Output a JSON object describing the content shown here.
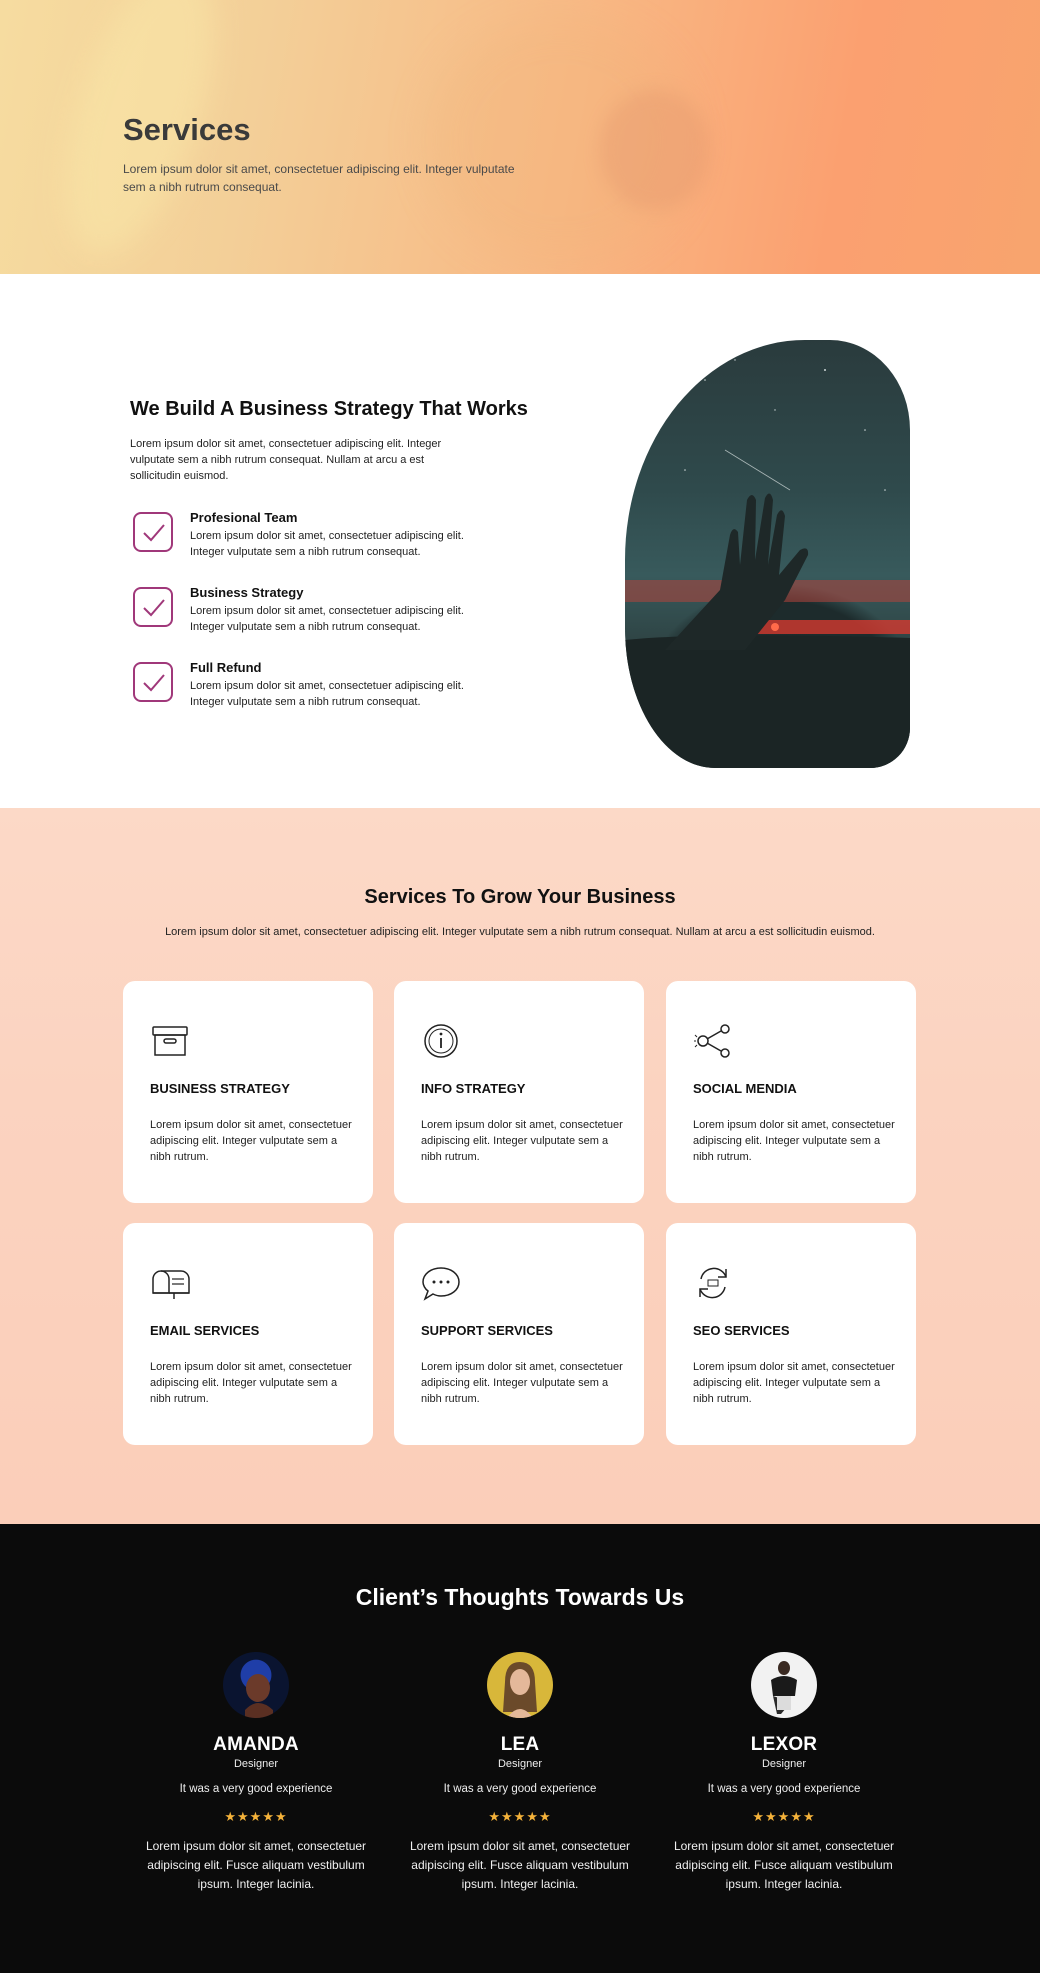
{
  "hero": {
    "title": "Services",
    "text": "Lorem ipsum dolor sit amet, consectetuer adipiscing elit. Integer vulputate sem a nibh rutrum consequat."
  },
  "strategy": {
    "title": "We Build A Business Strategy That Works",
    "lead": "Lorem ipsum dolor sit amet, consectetuer adipiscing elit. Integer vulputate sem a nibh rutrum consequat. Nullam at arcu a est sollicitudin euismod.",
    "features": [
      {
        "title": "Profesional Team",
        "text": "Lorem ipsum dolor sit amet, consectetuer adipiscing elit. Integer vulputate sem a nibh rutrum consequat."
      },
      {
        "title": "Business Strategy",
        "text": "Lorem ipsum dolor sit amet, consectetuer adipiscing elit. Integer vulputate sem a nibh rutrum consequat."
      },
      {
        "title": "Full Refund",
        "text": "Lorem ipsum dolor sit amet, consectetuer adipiscing elit. Integer vulputate sem a nibh rutrum consequat."
      }
    ],
    "check_color": "#a0387a"
  },
  "services": {
    "title": "Services To Grow Your Business",
    "subtitle": "Lorem ipsum dolor sit amet, consectetuer adipiscing elit. Integer vulputate sem a nibh rutrum consequat. Nullam at arcu a est sollicitudin euismod.",
    "cards": [
      {
        "icon": "archive-box-icon",
        "title": "BUSINESS STRATEGY",
        "text": "Lorem ipsum dolor sit amet, consectetuer adipiscing elit. Integer vulputate sem a nibh rutrum."
      },
      {
        "icon": "info-icon",
        "title": "INFO STRATEGY",
        "text": "Lorem ipsum dolor sit amet, consectetuer adipiscing elit. Integer vulputate sem a nibh rutrum."
      },
      {
        "icon": "share-icon",
        "title": "SOCIAL MENDIA",
        "text": "Lorem ipsum dolor sit amet, consectetuer adipiscing elit. Integer vulputate sem a nibh rutrum."
      },
      {
        "icon": "mailbox-icon",
        "title": "EMAIL SERVICES",
        "text": "Lorem ipsum dolor sit amet, consectetuer adipiscing elit. Integer vulputate sem a nibh rutrum."
      },
      {
        "icon": "chat-bubble-icon",
        "title": "SUPPORT SERVICES",
        "text": "Lorem ipsum dolor sit amet, consectetuer adipiscing elit. Integer vulputate sem a nibh rutrum."
      },
      {
        "icon": "refresh-icon",
        "title": "SEO SERVICES",
        "text": "Lorem ipsum dolor sit amet, consectetuer adipiscing elit. Integer vulputate sem a nibh rutrum."
      }
    ]
  },
  "testimonials": {
    "title": "Client’s Thoughts Towards Us",
    "star_color": "#f4b23a",
    "people": [
      {
        "name": "AMANDA",
        "role": "Designer",
        "quote": "It was a very good experience",
        "stars": "★★★★★",
        "rating": 5,
        "review": "Lorem ipsum dolor sit amet, consectetuer adipiscing elit. Fusce aliquam vestibulum ipsum. Integer lacinia."
      },
      {
        "name": "LEA",
        "role": "Designer",
        "quote": "It was a very good experience",
        "stars": "★★★★★",
        "rating": 5,
        "review": "Lorem ipsum dolor sit amet, consectetuer adipiscing elit. Fusce aliquam vestibulum ipsum. Integer lacinia."
      },
      {
        "name": "LEXOR",
        "role": "Designer",
        "quote": "It was a very good experience",
        "stars": "★★★★★",
        "rating": 5,
        "review": "Lorem ipsum dolor sit amet, consectetuer adipiscing elit. Fusce aliquam vestibulum ipsum. Integer lacinia."
      }
    ]
  }
}
